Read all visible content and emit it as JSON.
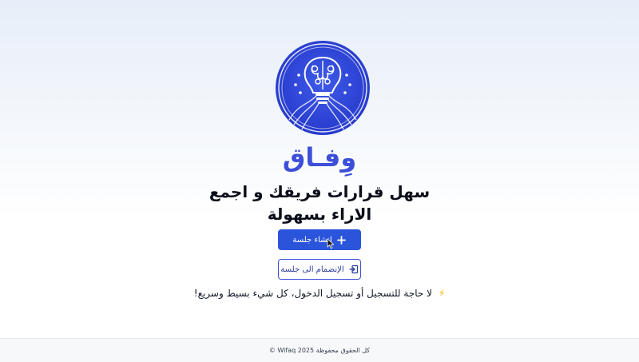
{
  "brand": {
    "name": "وِفـاق",
    "logo_icon": "brain-lightbulb-icon"
  },
  "hero": {
    "headline": "سهل قرارات فريقك و اجمع الاراء بسهولة"
  },
  "actions": {
    "create_session_label": "انشاء جلسة",
    "create_session_icon": "plus-icon",
    "join_session_label": "الإنضمام الى جلسة",
    "join_session_icon": "login-icon"
  },
  "note": {
    "icon": "lightning-icon",
    "text": "لا حاجة للتسجيل أو تسجيل الدخول، كل شيء بسيط وسريع!"
  },
  "footer": {
    "copyright": "كل الحقوق محفوظة 2025 Wifaq ©"
  },
  "colors": {
    "primary": "#2a55db",
    "brand": "#3b4fd8",
    "accent": "#f5b301"
  }
}
